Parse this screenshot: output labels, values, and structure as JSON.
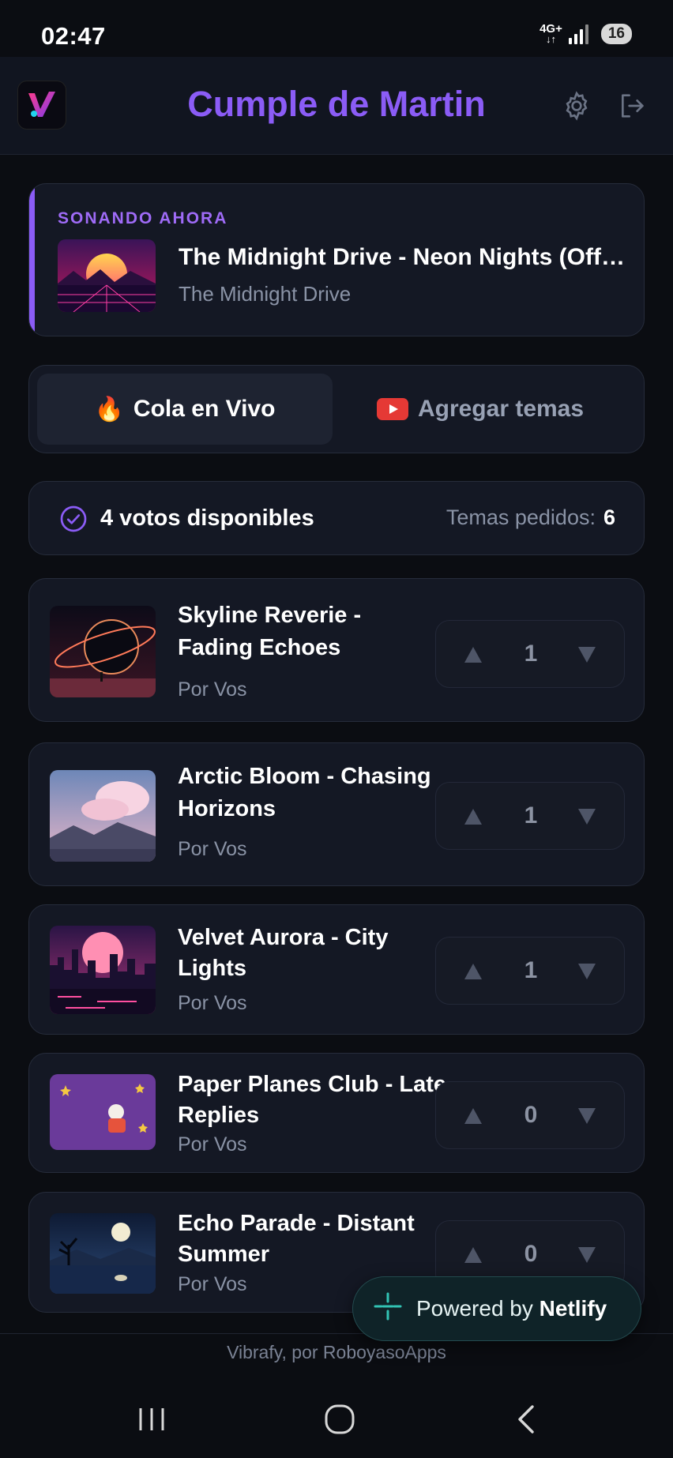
{
  "status_bar": {
    "time": "02:47",
    "network": "4G+",
    "battery": "16"
  },
  "header": {
    "title": "Cumple de Martin",
    "logo_icon": "vibrafy-logo-icon",
    "settings_icon": "gear-icon",
    "logout_icon": "logout-icon"
  },
  "now_playing": {
    "label": "SONANDO AHORA",
    "title": "The Midnight Drive - Neon Nights (Offi…",
    "artist": "The Midnight Drive"
  },
  "tabs": [
    {
      "emoji": "🔥",
      "label": "Cola en Vivo",
      "active": true
    },
    {
      "label": "Agregar temas",
      "active": false,
      "icon": "youtube-icon"
    }
  ],
  "votes": {
    "available": "4 votos disponibles",
    "requested_label": "Temas pedidos:",
    "requested_count": "6"
  },
  "queue": [
    {
      "title": "Skyline Reverie - Fading Echoes",
      "by": "Por Vos",
      "votes": "1"
    },
    {
      "title": "Arctic Bloom - Chasing Horizons",
      "by": "Por Vos",
      "votes": "1"
    },
    {
      "title": "Velvet Aurora - City Lights",
      "by": "Por Vos",
      "votes": "1"
    },
    {
      "title": "Paper Planes Club - Late Replies",
      "by": "Por Vos",
      "votes": "0"
    },
    {
      "title": "Echo Parade - Distant Summer",
      "by": "Por Vos",
      "votes": "0"
    }
  ],
  "netlify": {
    "prefix": "Powered by",
    "brand": "Netlify"
  },
  "footer": {
    "text": "Vibrafy, por RoboyasoApps"
  },
  "colors": {
    "accent": "#8b5cf6",
    "background": "#0b0d12",
    "card": "#141824"
  }
}
